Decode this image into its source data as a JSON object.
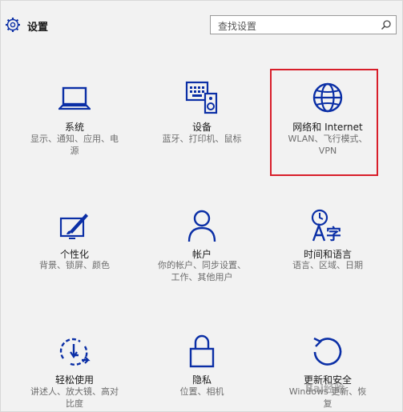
{
  "header": {
    "title": "设置",
    "search_placeholder": "查找设置",
    "icons": {
      "settings": "gear-icon",
      "search": "search-icon"
    }
  },
  "colors": {
    "accent": "#0b2fa6",
    "highlight": "#d81e2a"
  },
  "tiles": [
    {
      "name": "系统",
      "desc": [
        "显示、通知、应用、电",
        "源"
      ],
      "icon": "laptop-icon"
    },
    {
      "name": "设备",
      "desc": [
        "蓝牙、打印机、鼠标"
      ],
      "icon": "devices-icon"
    },
    {
      "name": "网络和 Internet",
      "desc": [
        "WLAN、飞行模式、",
        "VPN"
      ],
      "icon": "globe-icon"
    },
    {
      "name": "个性化",
      "desc": [
        "背景、锁屏、颜色"
      ],
      "icon": "paint-icon"
    },
    {
      "name": "帐户",
      "desc": [
        "你的帐户、同步设置、",
        "工作、其他用户"
      ],
      "icon": "person-icon"
    },
    {
      "name": "时间和语言",
      "desc": [
        "语言、区域、日期"
      ],
      "icon": "time-language-icon"
    },
    {
      "name": "轻松使用",
      "desc": [
        "讲述人、放大镜、高对",
        "比度"
      ],
      "icon": "ease-of-access-icon"
    },
    {
      "name": "隐私",
      "desc": [
        "位置、相机"
      ],
      "icon": "lock-icon"
    },
    {
      "name": "更新和安全",
      "desc": [
        "Windows 更新、恢",
        "复"
      ],
      "icon": "update-icon"
    }
  ],
  "watermark": "Bai经验"
}
